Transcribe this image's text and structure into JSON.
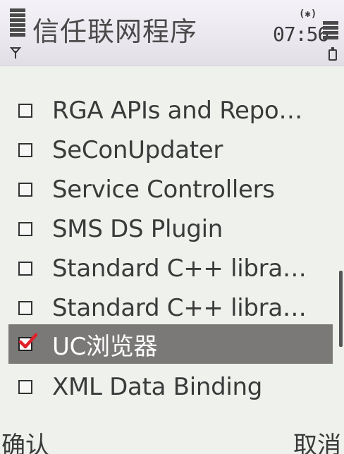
{
  "statusbar": {
    "title": "信任联网程序",
    "bluetooth_indicator": "(✱)",
    "time": "07:56",
    "icons": [
      "signal-strength-icon",
      "antenna-icon",
      "bluetooth-icon",
      "battery-level-icon",
      "battery-icon"
    ]
  },
  "list": {
    "items": [
      {
        "label": "RGA APIs and Repo…",
        "checked": false,
        "selected": false
      },
      {
        "label": "SeConUpdater",
        "checked": false,
        "selected": false
      },
      {
        "label": "Service Controllers",
        "checked": false,
        "selected": false
      },
      {
        "label": "SMS DS Plugin",
        "checked": false,
        "selected": false
      },
      {
        "label": "Standard C++ libra…",
        "checked": false,
        "selected": false
      },
      {
        "label": "Standard C++ libra…",
        "checked": false,
        "selected": false
      },
      {
        "label": "UC浏览器",
        "checked": true,
        "selected": true
      },
      {
        "label": "XML Data Binding",
        "checked": false,
        "selected": false
      }
    ]
  },
  "softkeys": {
    "left_label": "确认",
    "right_label": "取消"
  },
  "colors": {
    "background": "#eef1ec",
    "highlight": "#7b7978",
    "checkmark": "#e0202a",
    "text": "#3a3a3a"
  }
}
